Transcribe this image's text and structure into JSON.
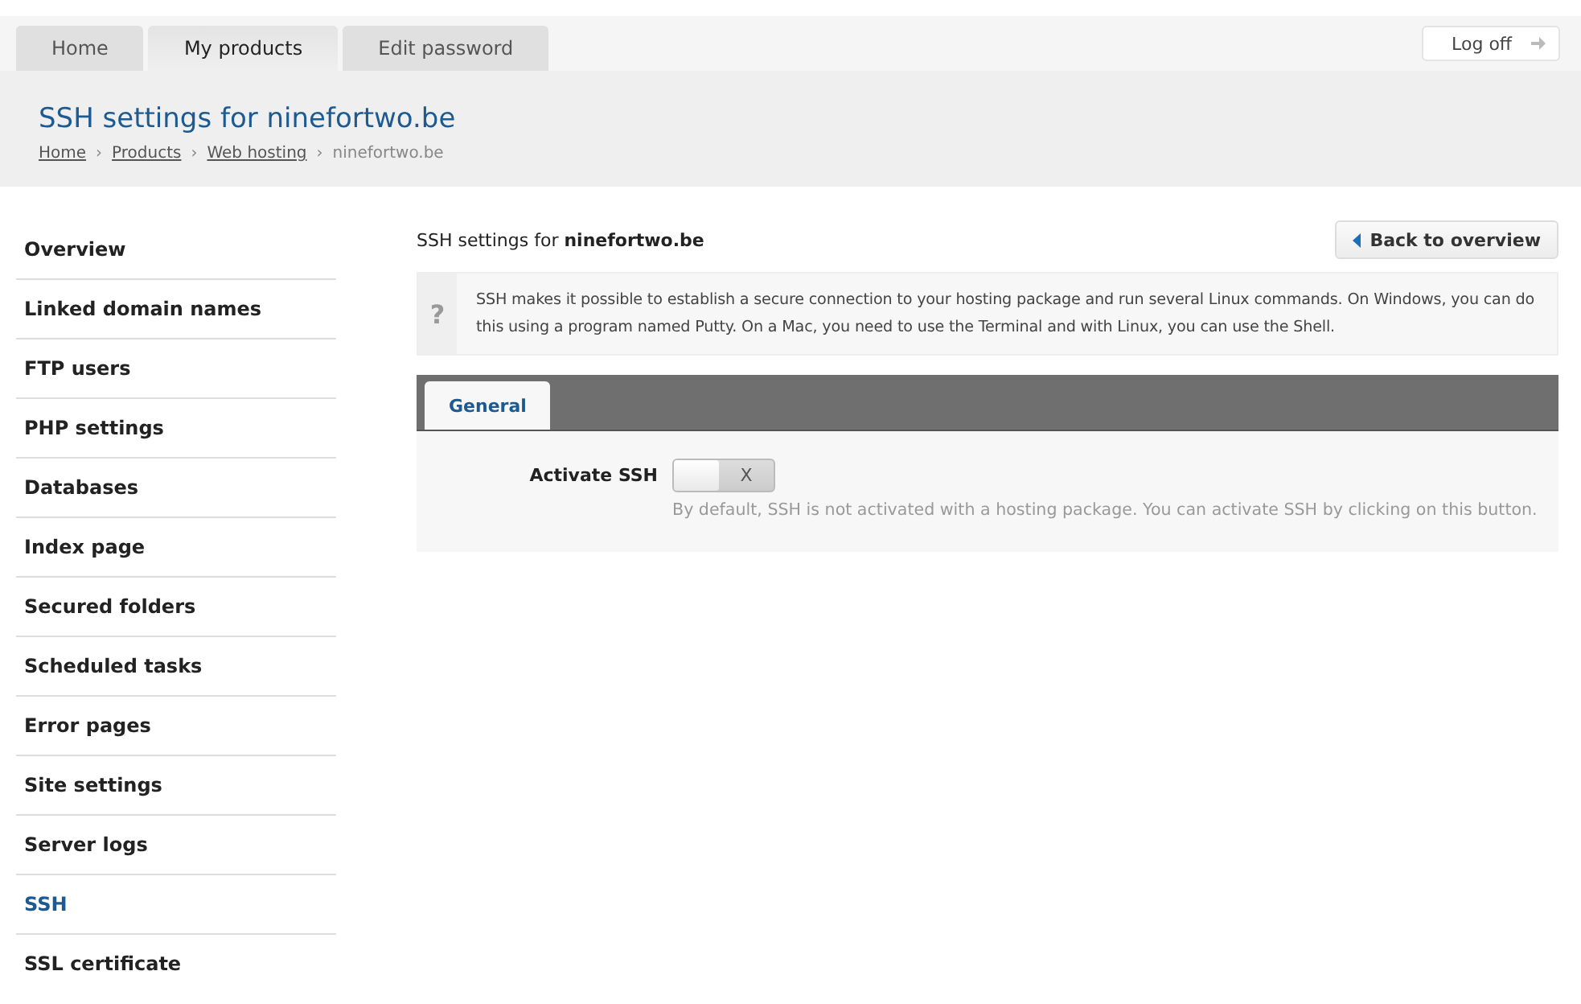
{
  "top_tabs": [
    {
      "label": "Home",
      "selected": false
    },
    {
      "label": "My products",
      "selected": true
    },
    {
      "label": "Edit password",
      "selected": false
    }
  ],
  "logoff": {
    "label": "Log off"
  },
  "header": {
    "title": "SSH settings for ninefortwo.be",
    "breadcrumb": [
      {
        "label": "Home",
        "link": true
      },
      {
        "label": "Products",
        "link": true
      },
      {
        "label": "Web hosting",
        "link": true
      },
      {
        "label": "ninefortwo.be",
        "link": false
      }
    ],
    "separator": "›"
  },
  "sidebar": {
    "items": [
      {
        "label": "Overview",
        "selected": false
      },
      {
        "label": "Linked domain names",
        "selected": false
      },
      {
        "label": "FTP users",
        "selected": false
      },
      {
        "label": "PHP settings",
        "selected": false
      },
      {
        "label": "Databases",
        "selected": false
      },
      {
        "label": "Index page",
        "selected": false
      },
      {
        "label": "Secured folders",
        "selected": false
      },
      {
        "label": "Scheduled tasks",
        "selected": false
      },
      {
        "label": "Error pages",
        "selected": false
      },
      {
        "label": "Site settings",
        "selected": false
      },
      {
        "label": "Server logs",
        "selected": false
      },
      {
        "label": "SSH",
        "selected": true
      },
      {
        "label": "SSL certificate",
        "selected": false
      }
    ]
  },
  "content": {
    "heading": "SSH settings for **ninefortwo.be**",
    "back_button": "Back to overview",
    "info": {
      "icon": "?",
      "text": "SSH makes it possible to establish a secure connection to your hosting package and run several Linux commands. On Windows, you can do this using a program named Putty. On a Mac, you need to use the Terminal and with Linux, you can use the Shell."
    },
    "tabs": [
      {
        "label": "General",
        "selected": true
      }
    ],
    "fields": [
      {
        "label": "Activate SSH",
        "toggle_label": "X",
        "on": false,
        "help": "By default, SSH is not activated with a hosting package. You can activate SSH by clicking on this button."
      }
    ]
  }
}
